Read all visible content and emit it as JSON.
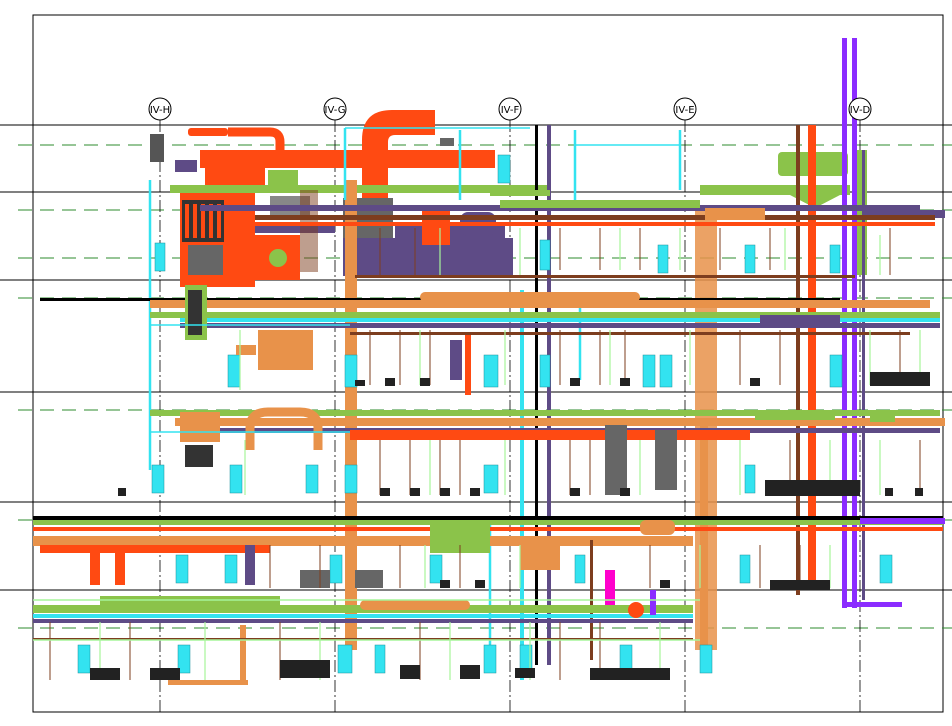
{
  "drawing": {
    "grid_labels": [
      "IV-H",
      "IV-G",
      "IV-F",
      "IV-E",
      "IV-D"
    ]
  },
  "colors": {
    "hot_water_pipe": "#ff4a12",
    "supply_duct": "#e8924a",
    "return_duct": "#5e4b86",
    "chilled_pipe": "#8bc34a",
    "domestic_water": "#33e3f0",
    "vent": "#7d3d1e",
    "sprinkler": "#a6f59a",
    "fuel": "#8b2cff",
    "gridline": "#000000"
  }
}
